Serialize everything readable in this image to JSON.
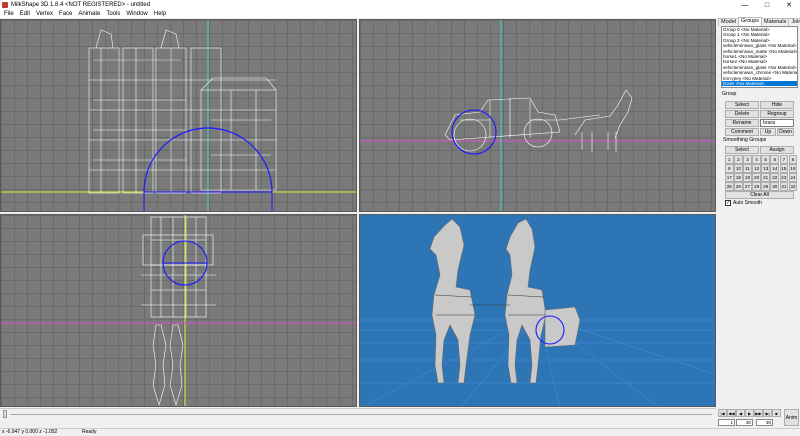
{
  "window": {
    "title": "MilkShape 3D 1.8.4 <NOT REGISTERED> - untitled",
    "minimize": "—",
    "maximize": "□",
    "close": "✕"
  },
  "menu": [
    "File",
    "Edit",
    "Vertex",
    "Face",
    "Animate",
    "Tools",
    "Window",
    "Help"
  ],
  "panel": {
    "tabs": [
      "Model",
      "Groups",
      "Materials",
      "Joints"
    ],
    "active_tab": "Groups",
    "groups": [
      "Group 0 <No Material>",
      "Group 1 <No Material>",
      "Group 2 <No Material>",
      "vehicleminivan_glass <No Material>",
      "vehicleminivan_matte <No Material>",
      "horse1 <No Material>",
      "horse2 <No Material>",
      "vehicleminivan_glass <No Material>",
      "vehicleminivan_chrome <No Material>",
      "iron-grey <No Material>",
      "brass <No Material>"
    ],
    "selected_group_index": 10,
    "group_section": "Group",
    "select_label": "Select",
    "hide_label": "Hide",
    "delete_label": "Delete",
    "regroup_label": "Regroup",
    "rename_label": "Rename",
    "rename_value": "brass",
    "comment_label": "Comment",
    "up_label": "Up",
    "down_label": "Down",
    "smoothing_section": "Smoothing Groups",
    "sg_select_label": "Select",
    "sg_assign_label": "Assign",
    "smoothing_numbers": [
      "1",
      "2",
      "3",
      "4",
      "5",
      "6",
      "7",
      "8",
      "9",
      "10",
      "11",
      "12",
      "13",
      "14",
      "15",
      "16",
      "17",
      "18",
      "19",
      "20",
      "21",
      "22",
      "23",
      "24",
      "25",
      "26",
      "27",
      "28",
      "29",
      "30",
      "31",
      "32"
    ],
    "clear_all_label": "Clear All",
    "auto_smooth_label": "Auto Smooth",
    "auto_smooth_checked": true,
    "check_mark": "✓"
  },
  "anim": {
    "start_frame": "1",
    "end_frame": "30",
    "frame_total": "30",
    "anim_label": "Anim",
    "btn_icons": [
      "|◀",
      "◀◀",
      "◀",
      "▶",
      "▶▶",
      "▶|",
      "■"
    ]
  },
  "status": {
    "coords": "x -6.947 y 0.000 z -1.052",
    "ready": "Ready"
  },
  "colors": {
    "viewport_bg": "#7a7a7a",
    "perspective_bg": "#2e75b5",
    "wireframe": "#ffffff",
    "selection": "#1a1aff",
    "axis_x": "#e8e83a",
    "axis_y": "#3ad8d8",
    "axis_z": "#d84cd8",
    "selected_row": "#0078d7"
  }
}
